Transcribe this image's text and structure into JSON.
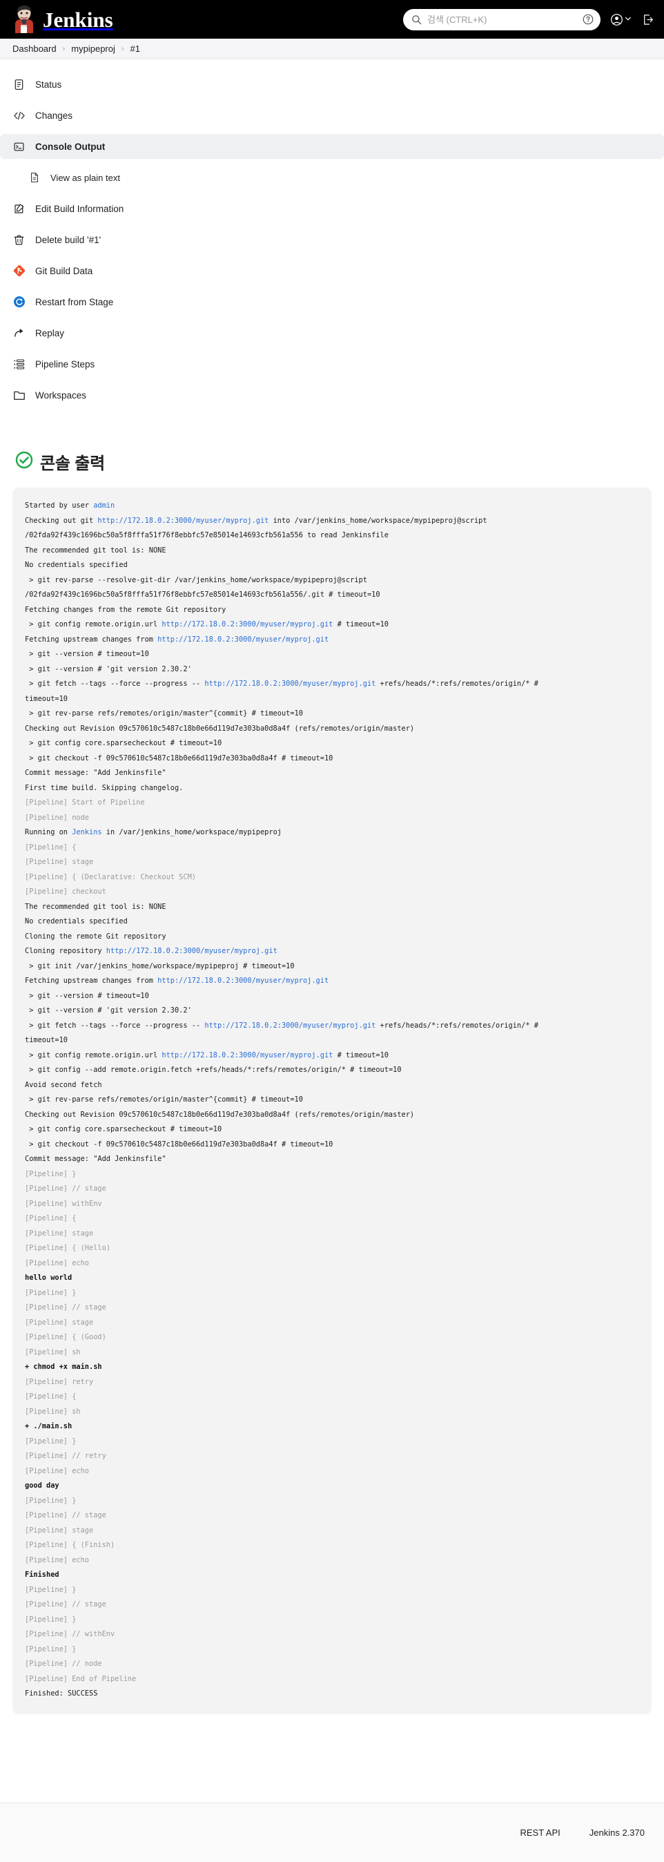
{
  "topbar": {
    "brand": "Jenkins",
    "search_placeholder": "검색 (CTRL+K)",
    "search_value": "",
    "help_icon": "help-circle-icon",
    "user_icon": "user-circle-icon",
    "logout_icon": "logout-icon"
  },
  "breadcrumb": {
    "items": [
      {
        "label": "Dashboard"
      },
      {
        "label": "mypipeproj"
      },
      {
        "label": "#1"
      }
    ],
    "separator": "›"
  },
  "sidebar": {
    "items": [
      {
        "label": "Status",
        "icon": "document-icon",
        "active": false,
        "sub": false
      },
      {
        "label": "Changes",
        "icon": "code-icon",
        "active": false,
        "sub": false
      },
      {
        "label": "Console Output",
        "icon": "terminal-icon",
        "active": true,
        "sub": false
      },
      {
        "label": "View as plain text",
        "icon": "file-text-icon",
        "active": false,
        "sub": true
      },
      {
        "label": "Edit Build Information",
        "icon": "edit-pencil-icon",
        "active": false,
        "sub": false
      },
      {
        "label": "Delete build '#1'",
        "icon": "trash-icon",
        "active": false,
        "sub": false
      },
      {
        "label": "Git Build Data",
        "icon": "git-icon",
        "active": false,
        "sub": false
      },
      {
        "label": "Restart from Stage",
        "icon": "restart-icon",
        "active": false,
        "sub": false
      },
      {
        "label": "Replay",
        "icon": "replay-arrow-icon",
        "active": false,
        "sub": false
      },
      {
        "label": "Pipeline Steps",
        "icon": "list-steps-icon",
        "active": false,
        "sub": false
      },
      {
        "label": "Workspaces",
        "icon": "folder-icon",
        "active": false,
        "sub": false
      }
    ]
  },
  "console": {
    "status_icon": "success-check-icon",
    "status_color": "#1ea64a",
    "title": "콘솔 출력",
    "lines": [
      [
        {
          "t": "Started by user ",
          "s": "plain"
        },
        {
          "t": "admin",
          "s": "link"
        }
      ],
      [
        {
          "t": "Checking out git ",
          "s": "plain"
        },
        {
          "t": "http://172.18.0.2:3000/myuser/myproj.git",
          "s": "link"
        },
        {
          "t": " into /var/jenkins_home/workspace/mypipeproj@script",
          "s": "plain"
        }
      ],
      [
        {
          "t": "/02fda92f439c1696bc50a5f8fffa51f76f8ebbfc57e85014e14693cfb561a556 to read Jenkinsfile",
          "s": "plain"
        }
      ],
      [
        {
          "t": "The recommended git tool is: NONE",
          "s": "plain"
        }
      ],
      [
        {
          "t": "No credentials specified",
          "s": "plain"
        }
      ],
      [
        {
          "t": " > git rev-parse --resolve-git-dir /var/jenkins_home/workspace/mypipeproj@script",
          "s": "plain"
        }
      ],
      [
        {
          "t": "/02fda92f439c1696bc50a5f8fffa51f76f8ebbfc57e85014e14693cfb561a556/.git # timeout=10",
          "s": "plain"
        }
      ],
      [
        {
          "t": "Fetching changes from the remote Git repository",
          "s": "plain"
        }
      ],
      [
        {
          "t": " > git config remote.origin.url ",
          "s": "plain"
        },
        {
          "t": "http://172.18.0.2:3000/myuser/myproj.git",
          "s": "link"
        },
        {
          "t": " # timeout=10",
          "s": "plain"
        }
      ],
      [
        {
          "t": "Fetching upstream changes from ",
          "s": "plain"
        },
        {
          "t": "http://172.18.0.2:3000/myuser/myproj.git",
          "s": "link"
        }
      ],
      [
        {
          "t": " > git --version # timeout=10",
          "s": "plain"
        }
      ],
      [
        {
          "t": " > git --version # 'git version 2.30.2'",
          "s": "plain"
        }
      ],
      [
        {
          "t": " > git fetch --tags --force --progress -- ",
          "s": "plain"
        },
        {
          "t": "http://172.18.0.2:3000/myuser/myproj.git",
          "s": "link"
        },
        {
          "t": " +refs/heads/*:refs/remotes/origin/* #",
          "s": "plain"
        }
      ],
      [
        {
          "t": "timeout=10",
          "s": "plain"
        }
      ],
      [
        {
          "t": " > git rev-parse refs/remotes/origin/master^{commit} # timeout=10",
          "s": "plain"
        }
      ],
      [
        {
          "t": "Checking out Revision 09c570610c5487c18b0e66d119d7e303ba0d8a4f (refs/remotes/origin/master)",
          "s": "plain"
        }
      ],
      [
        {
          "t": " > git config core.sparsecheckout # timeout=10",
          "s": "plain"
        }
      ],
      [
        {
          "t": " > git checkout -f 09c570610c5487c18b0e66d119d7e303ba0d8a4f # timeout=10",
          "s": "plain"
        }
      ],
      [
        {
          "t": "Commit message: \"Add Jenkinsfile\"",
          "s": "plain"
        }
      ],
      [
        {
          "t": "First time build. Skipping changelog.",
          "s": "plain"
        }
      ],
      [
        {
          "t": "[Pipeline] Start of Pipeline",
          "s": "pipeline"
        }
      ],
      [
        {
          "t": "[Pipeline] node",
          "s": "pipeline"
        }
      ],
      [
        {
          "t": "Running on ",
          "s": "plain"
        },
        {
          "t": "Jenkins",
          "s": "link"
        },
        {
          "t": " in /var/jenkins_home/workspace/mypipeproj",
          "s": "plain"
        }
      ],
      [
        {
          "t": "[Pipeline] {",
          "s": "pipeline"
        }
      ],
      [
        {
          "t": "[Pipeline] stage",
          "s": "pipeline"
        }
      ],
      [
        {
          "t": "[Pipeline] { (Declarative: Checkout SCM)",
          "s": "pipeline"
        }
      ],
      [
        {
          "t": "[Pipeline] checkout",
          "s": "pipeline"
        }
      ],
      [
        {
          "t": "The recommended git tool is: NONE",
          "s": "plain"
        }
      ],
      [
        {
          "t": "No credentials specified",
          "s": "plain"
        }
      ],
      [
        {
          "t": "Cloning the remote Git repository",
          "s": "plain"
        }
      ],
      [
        {
          "t": "Cloning repository ",
          "s": "plain"
        },
        {
          "t": "http://172.18.0.2:3000/myuser/myproj.git",
          "s": "link"
        }
      ],
      [
        {
          "t": " > git init /var/jenkins_home/workspace/mypipeproj # timeout=10",
          "s": "plain"
        }
      ],
      [
        {
          "t": "Fetching upstream changes from ",
          "s": "plain"
        },
        {
          "t": "http://172.18.0.2:3000/myuser/myproj.git",
          "s": "link"
        }
      ],
      [
        {
          "t": " > git --version # timeout=10",
          "s": "plain"
        }
      ],
      [
        {
          "t": " > git --version # 'git version 2.30.2'",
          "s": "plain"
        }
      ],
      [
        {
          "t": " > git fetch --tags --force --progress -- ",
          "s": "plain"
        },
        {
          "t": "http://172.18.0.2:3000/myuser/myproj.git",
          "s": "link"
        },
        {
          "t": " +refs/heads/*:refs/remotes/origin/* #",
          "s": "plain"
        }
      ],
      [
        {
          "t": "timeout=10",
          "s": "plain"
        }
      ],
      [
        {
          "t": " > git config remote.origin.url ",
          "s": "plain"
        },
        {
          "t": "http://172.18.0.2:3000/myuser/myproj.git",
          "s": "link"
        },
        {
          "t": " # timeout=10",
          "s": "plain"
        }
      ],
      [
        {
          "t": " > git config --add remote.origin.fetch +refs/heads/*:refs/remotes/origin/* # timeout=10",
          "s": "plain"
        }
      ],
      [
        {
          "t": "Avoid second fetch",
          "s": "plain"
        }
      ],
      [
        {
          "t": " > git rev-parse refs/remotes/origin/master^{commit} # timeout=10",
          "s": "plain"
        }
      ],
      [
        {
          "t": "Checking out Revision 09c570610c5487c18b0e66d119d7e303ba0d8a4f (refs/remotes/origin/master)",
          "s": "plain"
        }
      ],
      [
        {
          "t": " > git config core.sparsecheckout # timeout=10",
          "s": "plain"
        }
      ],
      [
        {
          "t": " > git checkout -f 09c570610c5487c18b0e66d119d7e303ba0d8a4f # timeout=10",
          "s": "plain"
        }
      ],
      [
        {
          "t": "Commit message: \"Add Jenkinsfile\"",
          "s": "plain"
        }
      ],
      [
        {
          "t": "[Pipeline] }",
          "s": "pipeline"
        }
      ],
      [
        {
          "t": "[Pipeline] // stage",
          "s": "pipeline"
        }
      ],
      [
        {
          "t": "[Pipeline] withEnv",
          "s": "pipeline"
        }
      ],
      [
        {
          "t": "[Pipeline] {",
          "s": "pipeline"
        }
      ],
      [
        {
          "t": "[Pipeline] stage",
          "s": "pipeline"
        }
      ],
      [
        {
          "t": "[Pipeline] { (Hello)",
          "s": "pipeline"
        }
      ],
      [
        {
          "t": "[Pipeline] echo",
          "s": "pipeline"
        }
      ],
      [
        {
          "t": "hello world",
          "s": "em"
        }
      ],
      [
        {
          "t": "[Pipeline] }",
          "s": "pipeline"
        }
      ],
      [
        {
          "t": "[Pipeline] // stage",
          "s": "pipeline"
        }
      ],
      [
        {
          "t": "[Pipeline] stage",
          "s": "pipeline"
        }
      ],
      [
        {
          "t": "[Pipeline] { (Good)",
          "s": "pipeline"
        }
      ],
      [
        {
          "t": "[Pipeline] sh",
          "s": "pipeline"
        }
      ],
      [
        {
          "t": "+ chmod +x main.sh",
          "s": "em"
        }
      ],
      [
        {
          "t": "[Pipeline] retry",
          "s": "pipeline"
        }
      ],
      [
        {
          "t": "[Pipeline] {",
          "s": "pipeline"
        }
      ],
      [
        {
          "t": "[Pipeline] sh",
          "s": "pipeline"
        }
      ],
      [
        {
          "t": "+ ./main.sh",
          "s": "em"
        }
      ],
      [
        {
          "t": "[Pipeline] }",
          "s": "pipeline"
        }
      ],
      [
        {
          "t": "[Pipeline] // retry",
          "s": "pipeline"
        }
      ],
      [
        {
          "t": "[Pipeline] echo",
          "s": "pipeline"
        }
      ],
      [
        {
          "t": "good day",
          "s": "em"
        }
      ],
      [
        {
          "t": "[Pipeline] }",
          "s": "pipeline"
        }
      ],
      [
        {
          "t": "[Pipeline] // stage",
          "s": "pipeline"
        }
      ],
      [
        {
          "t": "[Pipeline] stage",
          "s": "pipeline"
        }
      ],
      [
        {
          "t": "[Pipeline] { (Finish)",
          "s": "pipeline"
        }
      ],
      [
        {
          "t": "[Pipeline] echo",
          "s": "pipeline"
        }
      ],
      [
        {
          "t": "Finished",
          "s": "em"
        }
      ],
      [
        {
          "t": "[Pipeline] }",
          "s": "pipeline"
        }
      ],
      [
        {
          "t": "[Pipeline] // stage",
          "s": "pipeline"
        }
      ],
      [
        {
          "t": "[Pipeline] }",
          "s": "pipeline"
        }
      ],
      [
        {
          "t": "[Pipeline] // withEnv",
          "s": "pipeline"
        }
      ],
      [
        {
          "t": "[Pipeline] }",
          "s": "pipeline"
        }
      ],
      [
        {
          "t": "[Pipeline] // node",
          "s": "pipeline"
        }
      ],
      [
        {
          "t": "[Pipeline] End of Pipeline",
          "s": "pipeline"
        }
      ],
      [
        {
          "t": "Finished: SUCCESS",
          "s": "plain"
        }
      ]
    ]
  },
  "footer": {
    "rest_api": "REST API",
    "version": "Jenkins 2.370"
  }
}
